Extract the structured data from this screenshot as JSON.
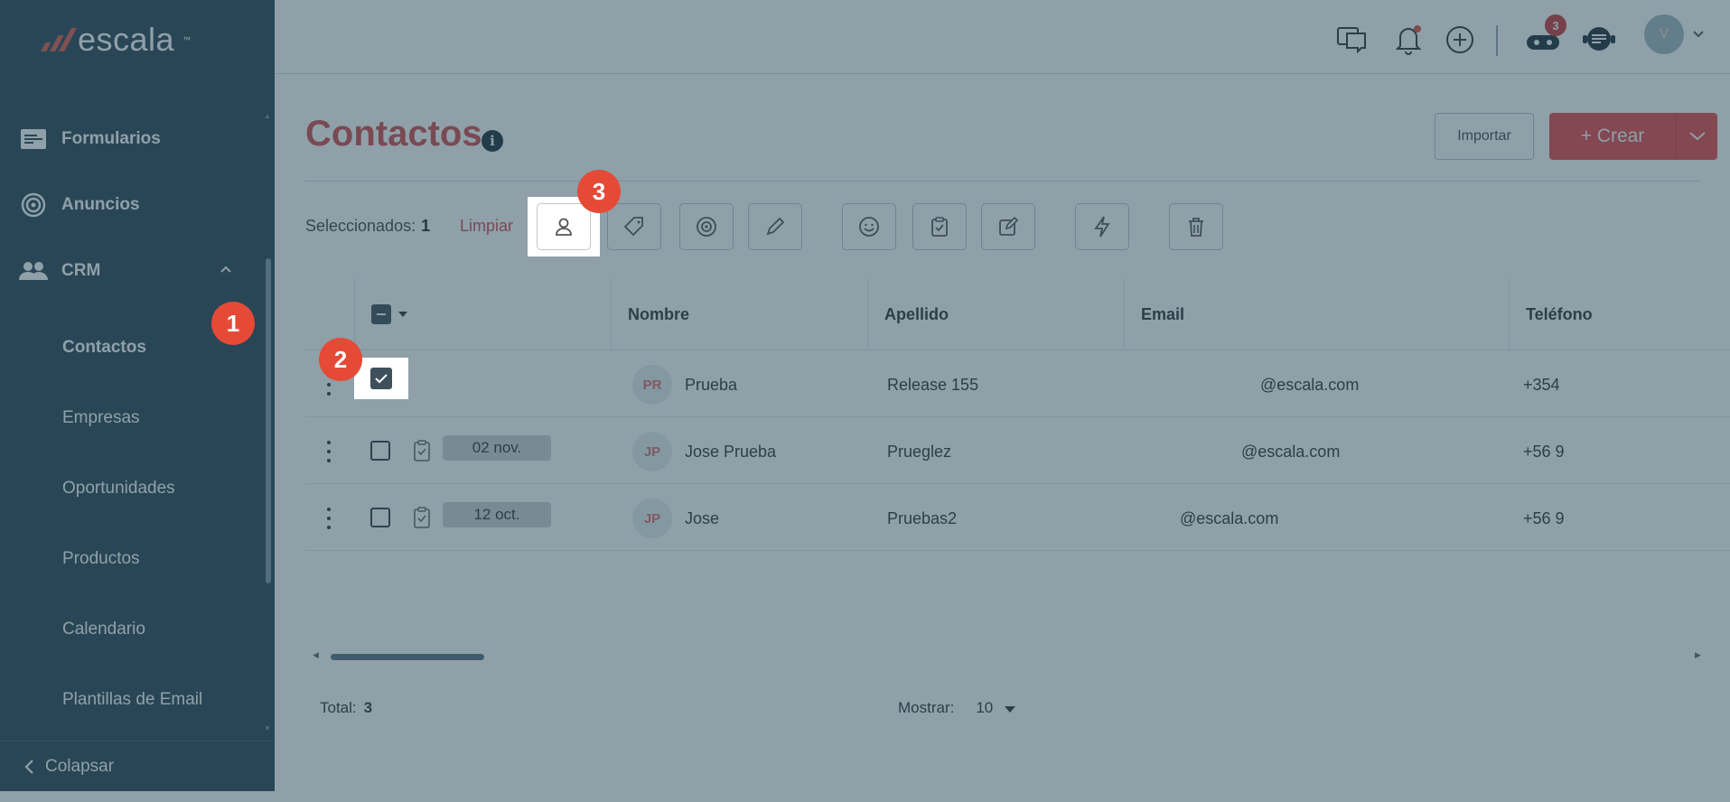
{
  "sidebar": {
    "brand": "escala",
    "items": [
      {
        "label": "Formularios",
        "icon": "form-icon"
      },
      {
        "label": "Anuncios",
        "icon": "target-icon"
      },
      {
        "label": "CRM",
        "icon": "people-icon"
      }
    ],
    "crm_sub": [
      "Contactos",
      "Empresas",
      "Oportunidades",
      "Productos",
      "Calendario",
      "Plantillas de Email"
    ],
    "collapse_label": "Colapsar"
  },
  "topbar": {
    "notification_count": "3",
    "avatar_initial": "V"
  },
  "page": {
    "title": "Contactos",
    "import_label": "Importar",
    "create_label": "+ Crear",
    "selected_label": "Seleccionados:",
    "selected_count": "1",
    "clear_label": "Limpiar"
  },
  "table": {
    "headers": [
      "Nombre",
      "Apellido",
      "Email",
      "Teléfono"
    ],
    "rows": [
      {
        "initials": "PR",
        "first": "Prueba",
        "last": "Release 155",
        "email": "@escala.com",
        "phone": "+354",
        "date": "",
        "checked": true
      },
      {
        "initials": "JP",
        "first": "Jose Prueba",
        "last": "Prueglez",
        "email": "@escala.com",
        "phone": "+56 9",
        "date": "02 nov.",
        "checked": false
      },
      {
        "initials": "JP",
        "first": "Jose",
        "last": "Pruebas2",
        "email": "@escala.com",
        "phone": "+56 9",
        "date": "12 oct.",
        "checked": false
      }
    ]
  },
  "footer": {
    "total_label": "Total:",
    "total_value": "3",
    "show_label": "Mostrar:",
    "show_value": "10"
  },
  "steps": [
    "1",
    "2",
    "3"
  ],
  "colors": {
    "accent": "#e54747",
    "sidebar": "#2b4453",
    "overlay": "#28485a"
  }
}
